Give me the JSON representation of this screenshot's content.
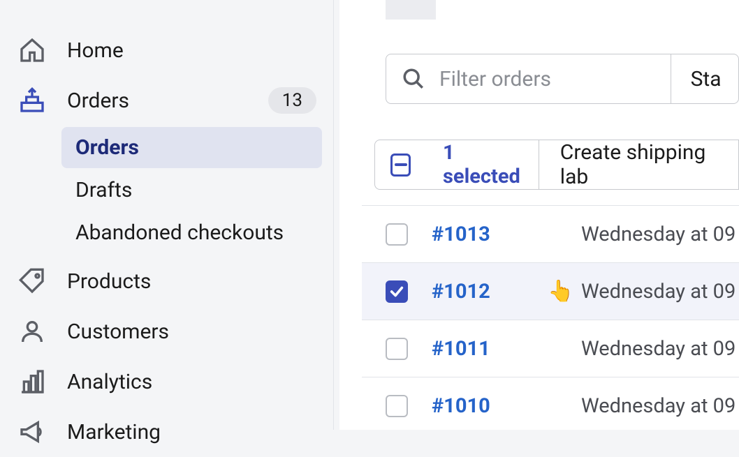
{
  "sidebar": {
    "items": [
      {
        "label": "Home"
      },
      {
        "label": "Orders",
        "badge": "13"
      },
      {
        "label": "Products"
      },
      {
        "label": "Customers"
      },
      {
        "label": "Analytics"
      },
      {
        "label": "Marketing"
      }
    ],
    "orders_subnav": [
      {
        "label": "Orders",
        "selected": true
      },
      {
        "label": "Drafts"
      },
      {
        "label": "Abandoned checkouts"
      }
    ]
  },
  "filter": {
    "placeholder": "Filter orders",
    "status_button": "Sta"
  },
  "bulk": {
    "selected_text": "1 selected",
    "action_label": "Create shipping lab"
  },
  "orders": [
    {
      "id": "#1013",
      "date": "Wednesday at 09",
      "checked": false
    },
    {
      "id": "#1012",
      "date": "Wednesday at 09",
      "checked": true
    },
    {
      "id": "#1011",
      "date": "Wednesday at 09",
      "checked": false
    },
    {
      "id": "#1010",
      "date": "Wednesday at 09",
      "checked": false
    }
  ]
}
